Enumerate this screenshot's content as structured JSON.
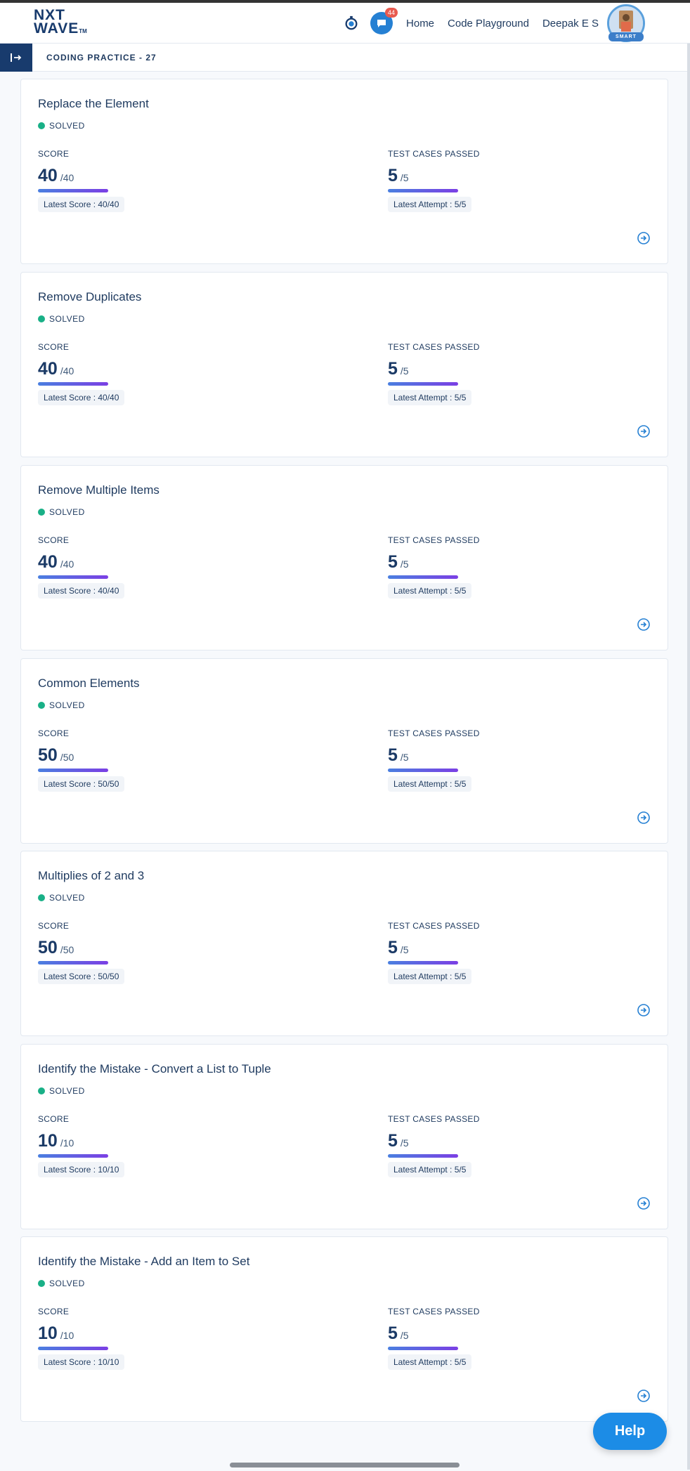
{
  "brand": {
    "logo_line1": "NXT",
    "logo_line2": "WAVE",
    "logo_tm": "TM"
  },
  "header": {
    "chat_badge": "44",
    "nav": [
      "Home",
      "Code Playground",
      "Deepak E S"
    ],
    "avatar_ribbon": "SMART"
  },
  "subbar": {
    "breadcrumb": "CODING PRACTICE - 27"
  },
  "labels": {
    "score": "SCORE",
    "tests": "TEST CASES PASSED"
  },
  "cards": [
    {
      "title": "Replace the Element",
      "status": "SOLVED",
      "score": "40",
      "score_max": "/40",
      "latest_score": "Latest Score : 40/40",
      "tests": "5",
      "tests_max": "/5",
      "latest_attempt": "Latest Attempt : 5/5"
    },
    {
      "title": "Remove Duplicates",
      "status": "SOLVED",
      "score": "40",
      "score_max": "/40",
      "latest_score": "Latest Score : 40/40",
      "tests": "5",
      "tests_max": "/5",
      "latest_attempt": "Latest Attempt : 5/5"
    },
    {
      "title": "Remove Multiple Items",
      "status": "SOLVED",
      "score": "40",
      "score_max": "/40",
      "latest_score": "Latest Score : 40/40",
      "tests": "5",
      "tests_max": "/5",
      "latest_attempt": "Latest Attempt : 5/5"
    },
    {
      "title": "Common Elements",
      "status": "SOLVED",
      "score": "50",
      "score_max": "/50",
      "latest_score": "Latest Score : 50/50",
      "tests": "5",
      "tests_max": "/5",
      "latest_attempt": "Latest Attempt : 5/5"
    },
    {
      "title": "Multiplies of 2 and 3",
      "status": "SOLVED",
      "score": "50",
      "score_max": "/50",
      "latest_score": "Latest Score : 50/50",
      "tests": "5",
      "tests_max": "/5",
      "latest_attempt": "Latest Attempt : 5/5"
    },
    {
      "title": "Identify the Mistake - Convert a List to Tuple",
      "status": "SOLVED",
      "score": "10",
      "score_max": "/10",
      "latest_score": "Latest Score : 10/10",
      "tests": "5",
      "tests_max": "/5",
      "latest_attempt": "Latest Attempt : 5/5"
    },
    {
      "title": "Identify the Mistake - Add an Item to Set",
      "status": "SOLVED",
      "score": "10",
      "score_max": "/10",
      "latest_score": "Latest Score : 10/10",
      "tests": "5",
      "tests_max": "/5",
      "latest_attempt": "Latest Attempt : 5/5"
    }
  ],
  "help": {
    "label": "Help"
  },
  "colors": {
    "brand_navy": "#183b6d",
    "solved_green": "#19b087",
    "help_blue": "#1c8ce6",
    "badge_red": "#e85a4f"
  }
}
